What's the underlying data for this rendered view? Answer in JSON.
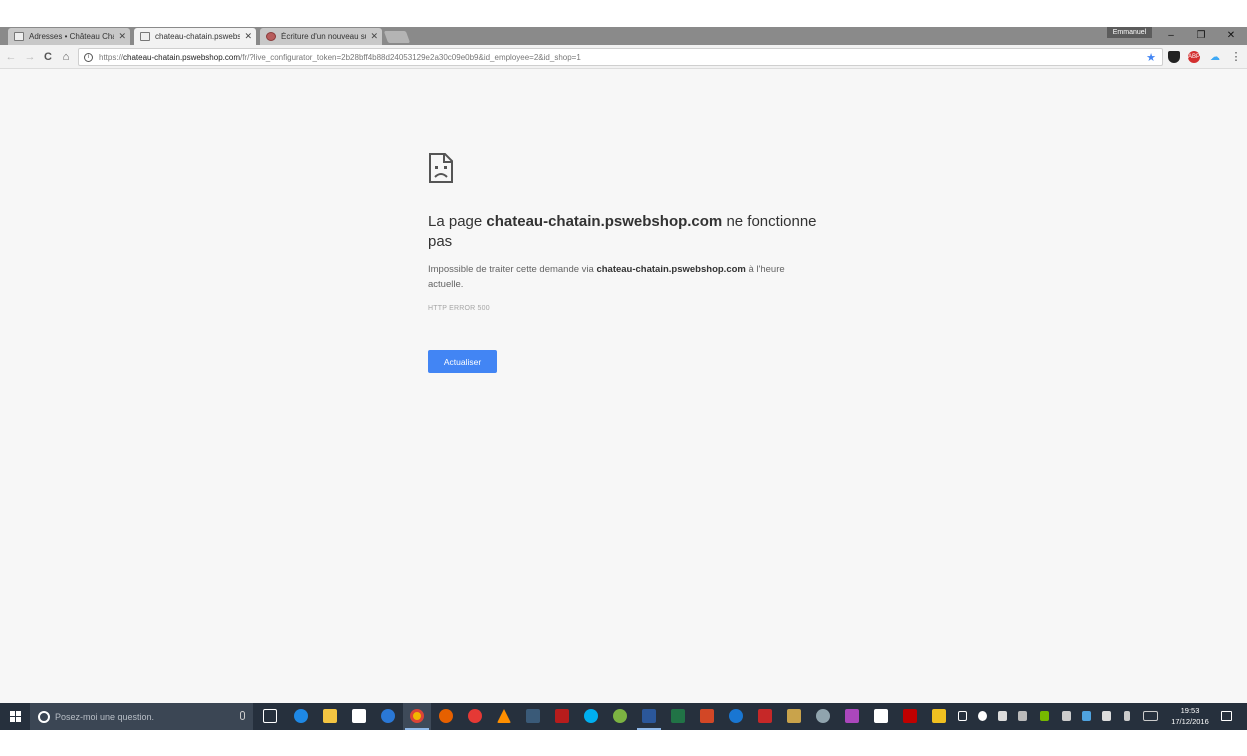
{
  "tabs": [
    {
      "title": "Adresses • Château Chat",
      "active": false
    },
    {
      "title": "chateau-chatain.pswebsh",
      "active": true
    },
    {
      "title": "Écriture d'un nouveau su",
      "active": false
    }
  ],
  "window": {
    "profile_name": "Emmanuel",
    "minimize": "–",
    "restore": "❐",
    "close": "✕"
  },
  "toolbar": {
    "back": "←",
    "forward": "→",
    "reload": "C",
    "home": "⌂",
    "url_scheme": "https://",
    "url_host": "chateau-chatain.pswebshop.com",
    "url_path": "/fr/?live_configurator_token=2b28bff4b88d24053129e2a30c09e0b9&id_employee=2&id_shop=1",
    "star": "★",
    "menu": "⋮"
  },
  "error_page": {
    "headline_prefix": "La page ",
    "headline_host": "chateau-chatain.pswebshop.com",
    "headline_suffix": " ne fonctionne pas",
    "desc_prefix": "Impossible de traiter cette demande via ",
    "desc_host": "chateau-chatain.pswebshop.com",
    "desc_suffix": " à l'heure actuelle.",
    "error_code": "HTTP ERROR 500",
    "reload_label": "Actualiser"
  },
  "taskbar": {
    "search_placeholder": "Posez-moi une question.",
    "time": "19:53",
    "date": "17/12/2016"
  },
  "colors": {
    "accent": "#4285f4",
    "tabstrip": "#8a8a8a",
    "page_bg": "#f7f7f7",
    "taskbar": "#26303d"
  }
}
